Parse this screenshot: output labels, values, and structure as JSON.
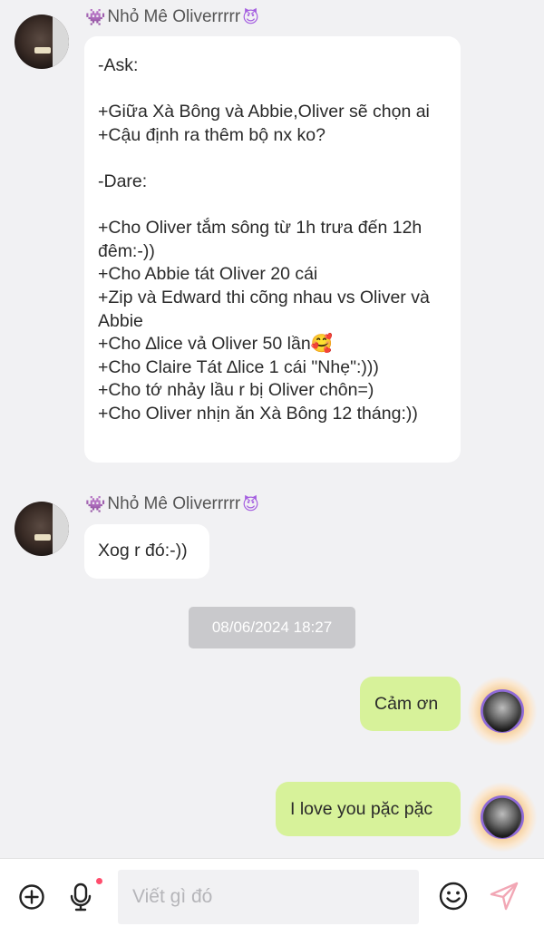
{
  "messages": [
    {
      "sender": {
        "prefix_emoji": "👾",
        "name": "Nhỏ Mê Oliverrrrr",
        "suffix_emoji": "😈"
      },
      "text": "-Ask:\n\n+Giữa Xà Bông và Abbie,Oliver sẽ chọn ai\n+Cậu định ra thêm bộ nx ko?\n\n-Dare:\n\n+Cho Oliver tắm sông từ 1h trưa đến 12h đêm:-))\n+Cho Abbie tát Oliver 20 cái\n+Zip và Edward thi cõng nhau vs Oliver và Abbie\n+Cho ∆lice vả Oliver 50 lần🥰\n+Cho Claire Tát ∆lice 1 cái \"Nhẹ\":)))\n+Cho tớ nhảy lầu r bị Oliver chôn=)\n+Cho Oliver nhịn ăn Xà Bông 12 tháng:))"
    },
    {
      "sender": {
        "prefix_emoji": "👾",
        "name": "Nhỏ Mê Oliverrrrr",
        "suffix_emoji": "😈"
      },
      "text": "Xog r đó:-))"
    }
  ],
  "timestamp": "08/06/2024 18:27",
  "outgoing": [
    {
      "text": "Cảm ơn"
    },
    {
      "text": "I love you pặc pặc"
    }
  ],
  "composer": {
    "placeholder": "Viết gì đó",
    "icons": {
      "add": "add-circle-icon",
      "mic": "microphone-icon",
      "emoji": "emoji-icon",
      "send": "send-icon"
    },
    "mic_badge_color": "#ff4d6d"
  },
  "colors": {
    "background": "#f1f1f3",
    "incoming_bubble": "#ffffff",
    "outgoing_bubble": "#d7f29a",
    "timestamp_pill": "#c9c9cc"
  }
}
